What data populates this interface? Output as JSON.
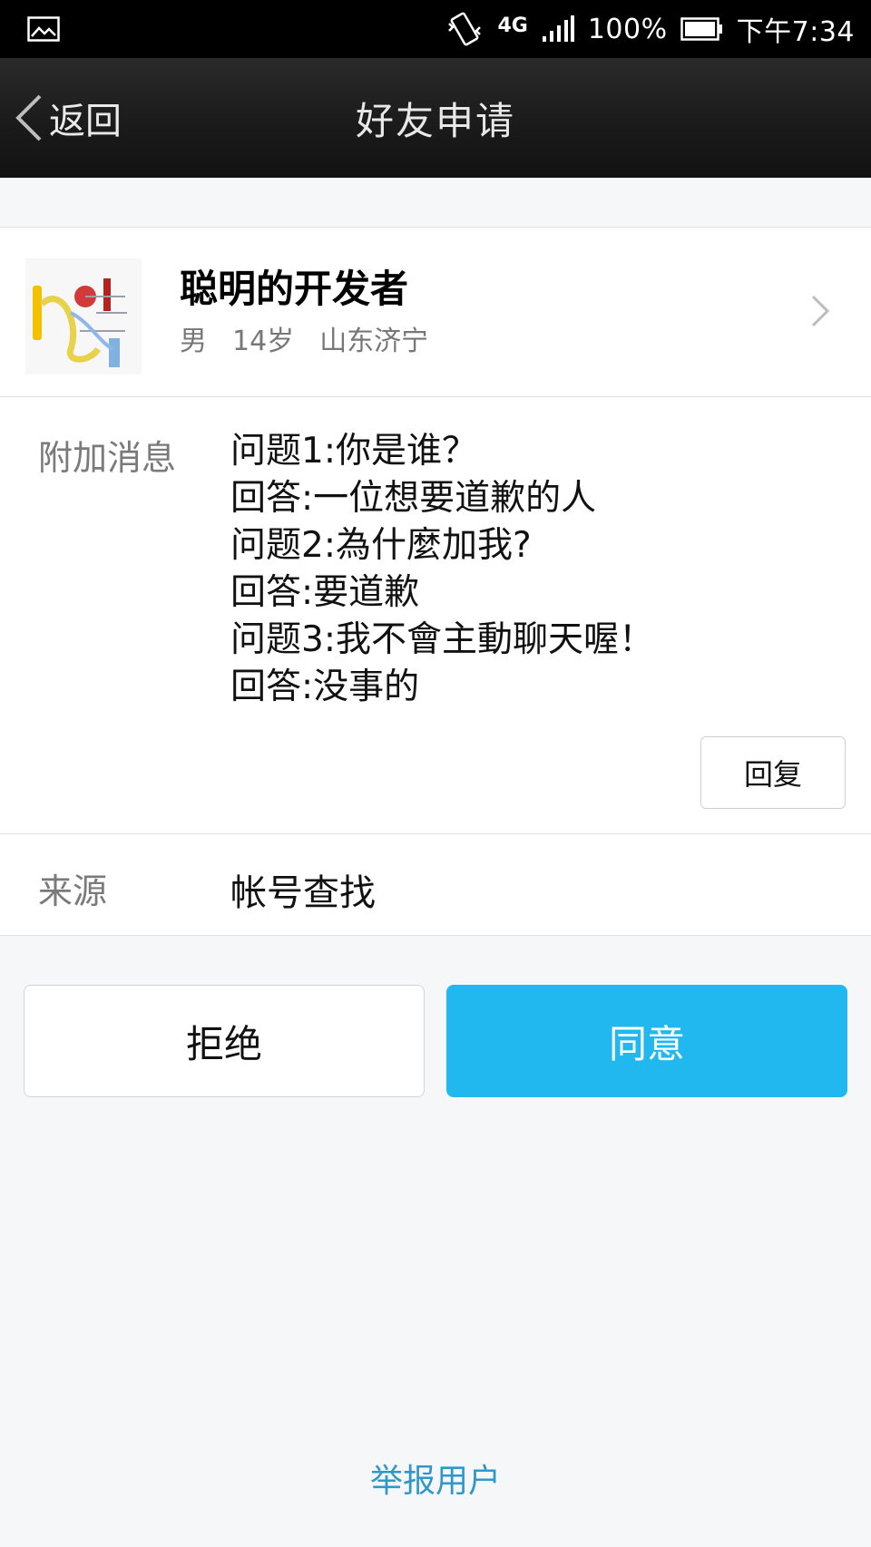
{
  "status_bar": {
    "network": "4G",
    "battery": "100%",
    "time": "下午7:34"
  },
  "header": {
    "back_label": "返回",
    "title": "好友申请"
  },
  "profile": {
    "nickname": "聪明的开发者",
    "gender": "男",
    "age": "14岁",
    "location": "山东济宁"
  },
  "message": {
    "label": "附加消息",
    "lines": [
      "问题1:你是谁？",
      "回答:一位想要道歉的人",
      "问题2:為什麼加我?",
      "回答:要道歉",
      "问题3:我不會主動聊天喔！",
      "回答:没事的"
    ],
    "reply_label": "回复"
  },
  "source": {
    "label": "来源",
    "value": "帐号查找"
  },
  "actions": {
    "reject_label": "拒绝",
    "accept_label": "同意"
  },
  "report_label": "举报用户",
  "colors": {
    "accent": "#21b8ef",
    "link": "#3197c8"
  }
}
